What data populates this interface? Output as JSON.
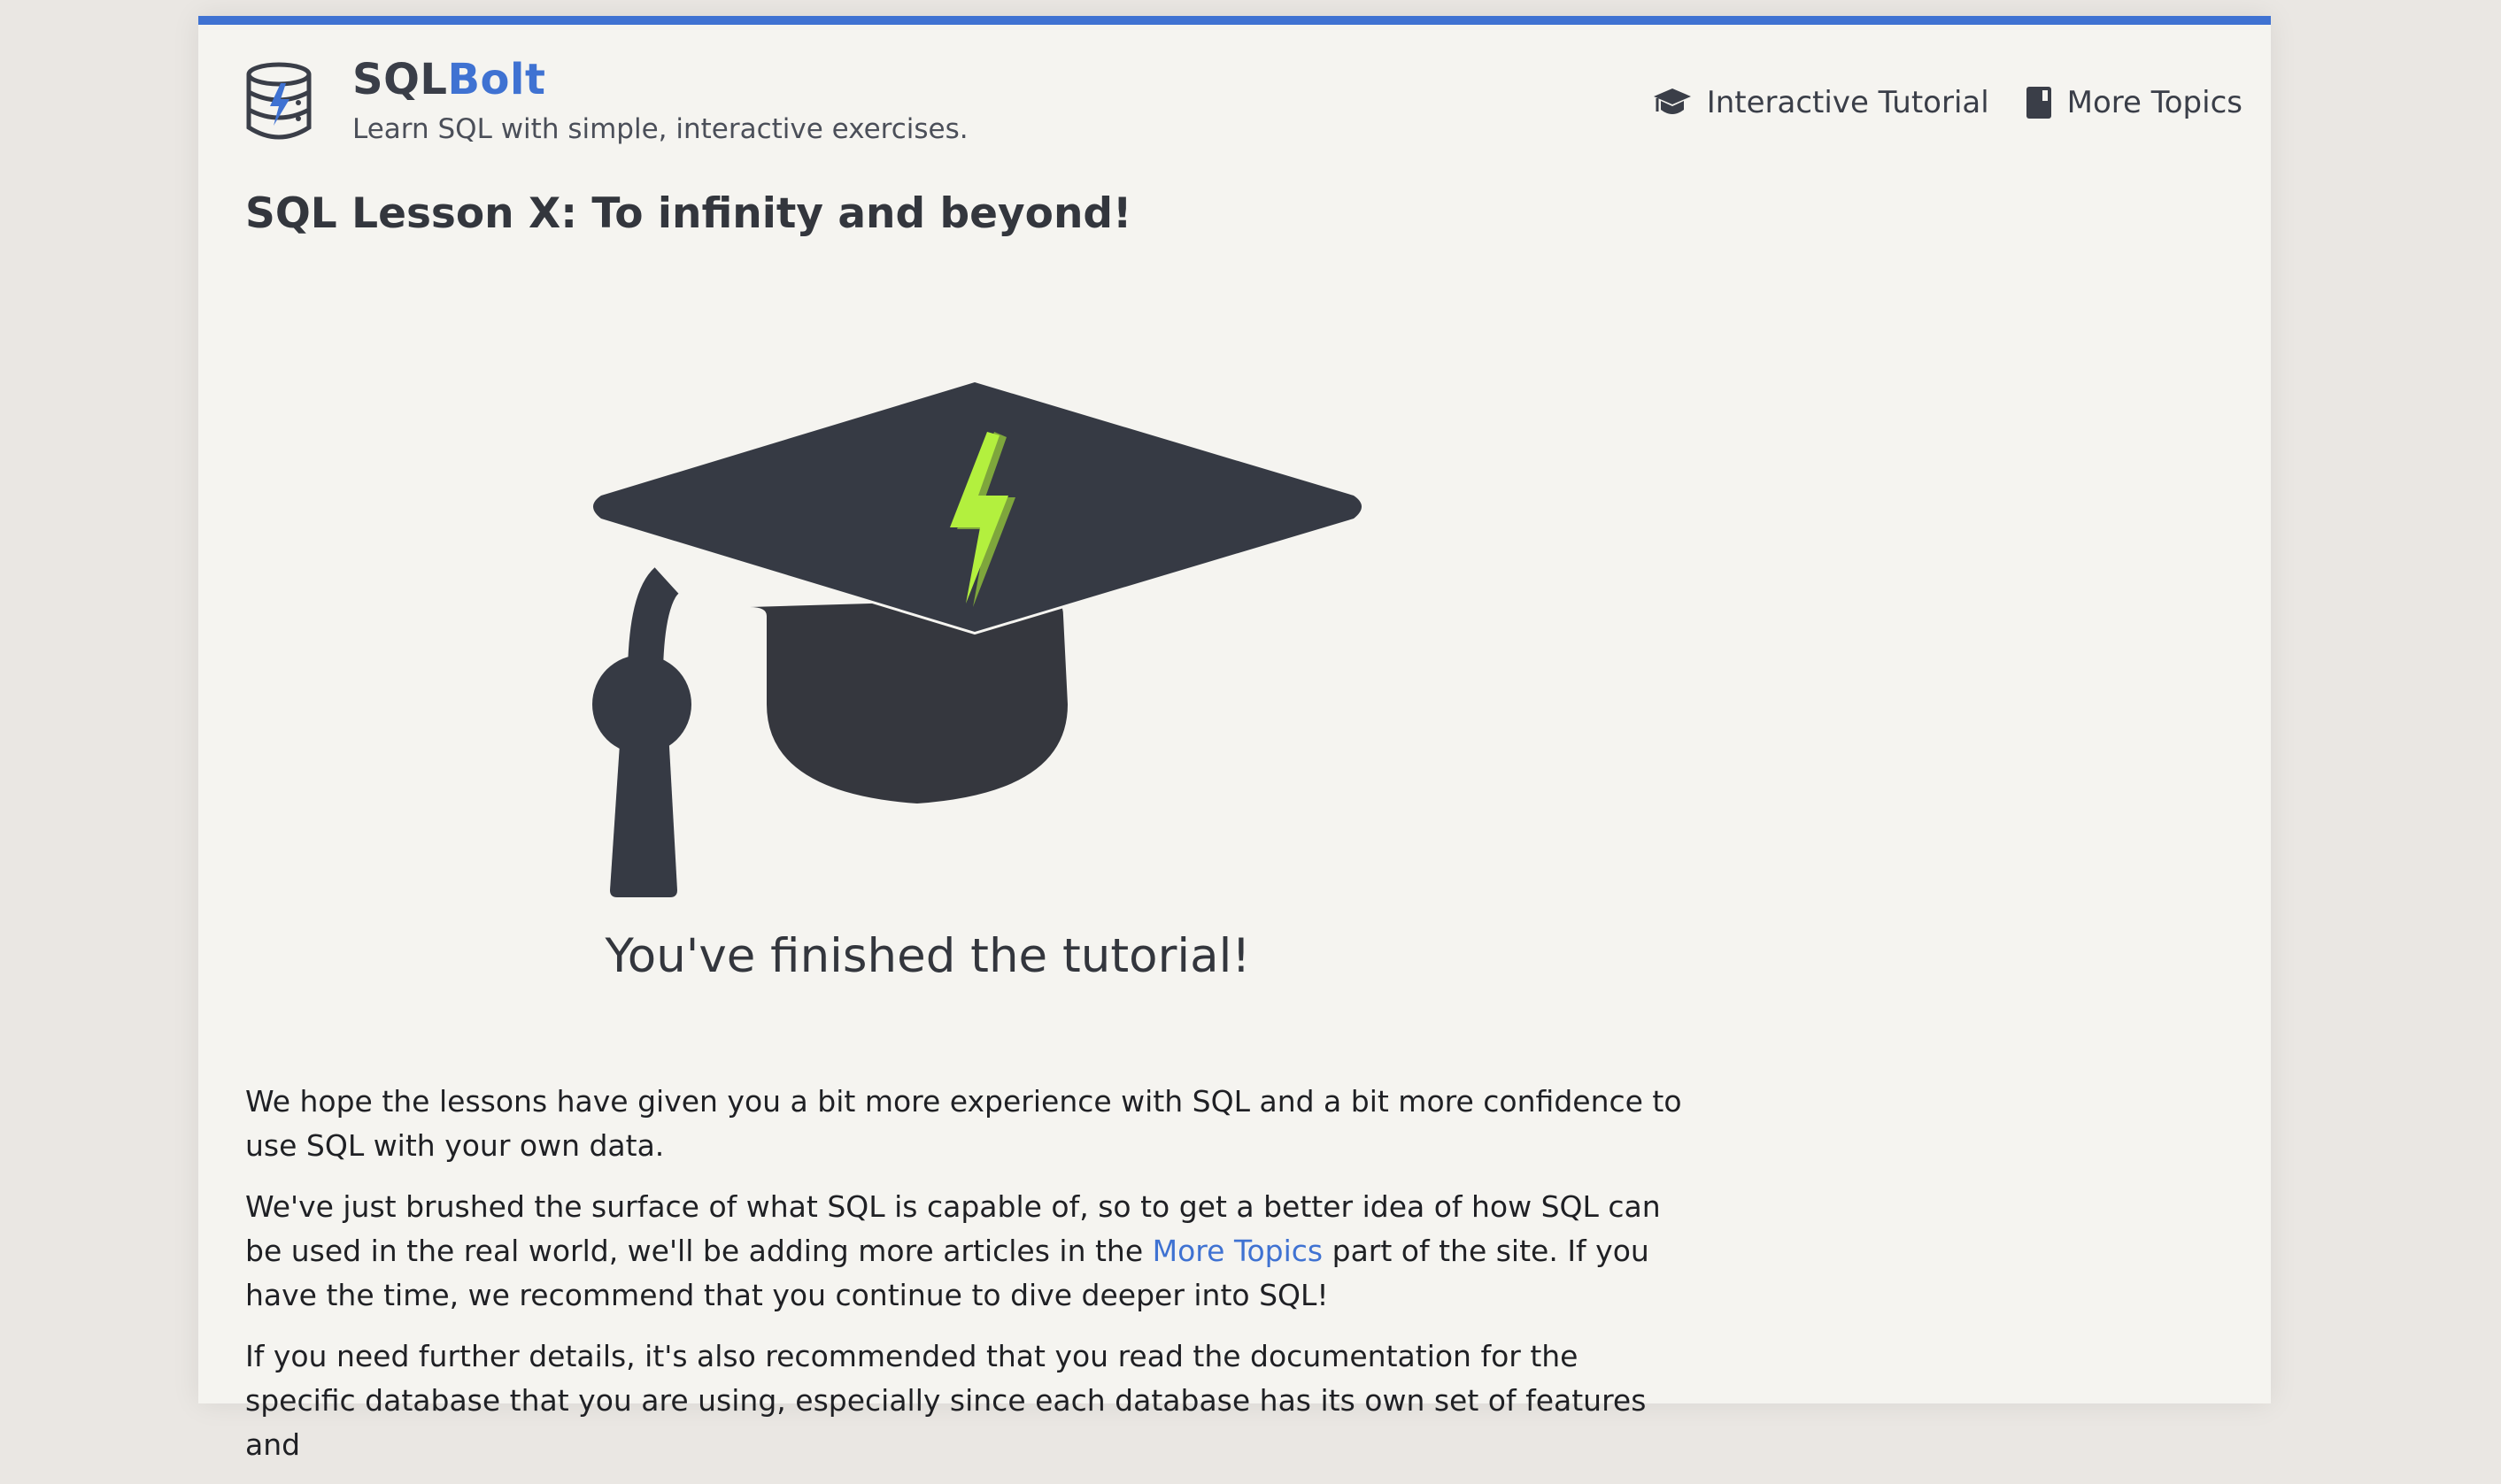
{
  "header": {
    "brand_part1": "SQL",
    "brand_part2": "Bolt",
    "tagline": "Learn SQL with simple, interactive exercises.",
    "logo_icon": "database-bolt-icon"
  },
  "nav": {
    "items": [
      {
        "label": "Interactive Tutorial",
        "icon": "graduation-cap-icon"
      },
      {
        "label": "More Topics",
        "icon": "book-icon"
      }
    ]
  },
  "lesson": {
    "title": "SQL Lesson X: To infinity and beyond!",
    "image_icon": "graduation-cap-bolt-icon",
    "finished_text": "You've finished the tutorial!"
  },
  "content": {
    "p1": "We hope the lessons have given you a bit more experience with SQL and a bit more confidence to use SQL with your own data.",
    "p2_before": "We've just brushed the surface of what SQL is capable of, so to get a better idea of how SQL can be used in the real world, we'll be adding more articles in the ",
    "p2_link": "More Topics",
    "p2_after": " part of the site. If you have the time, we recommend that you continue to dive deeper into SQL!",
    "p3": "If you need further details, it's also recommended that you read the documentation for the specific database that you are using, especially since each database has its own set of features and"
  },
  "colors": {
    "accent": "#3f72d2",
    "bolt_green": "#b3f03e",
    "cap_dark": "#363a44",
    "page_bg": "#f5f4f0",
    "outer_bg": "#eae7e3"
  }
}
